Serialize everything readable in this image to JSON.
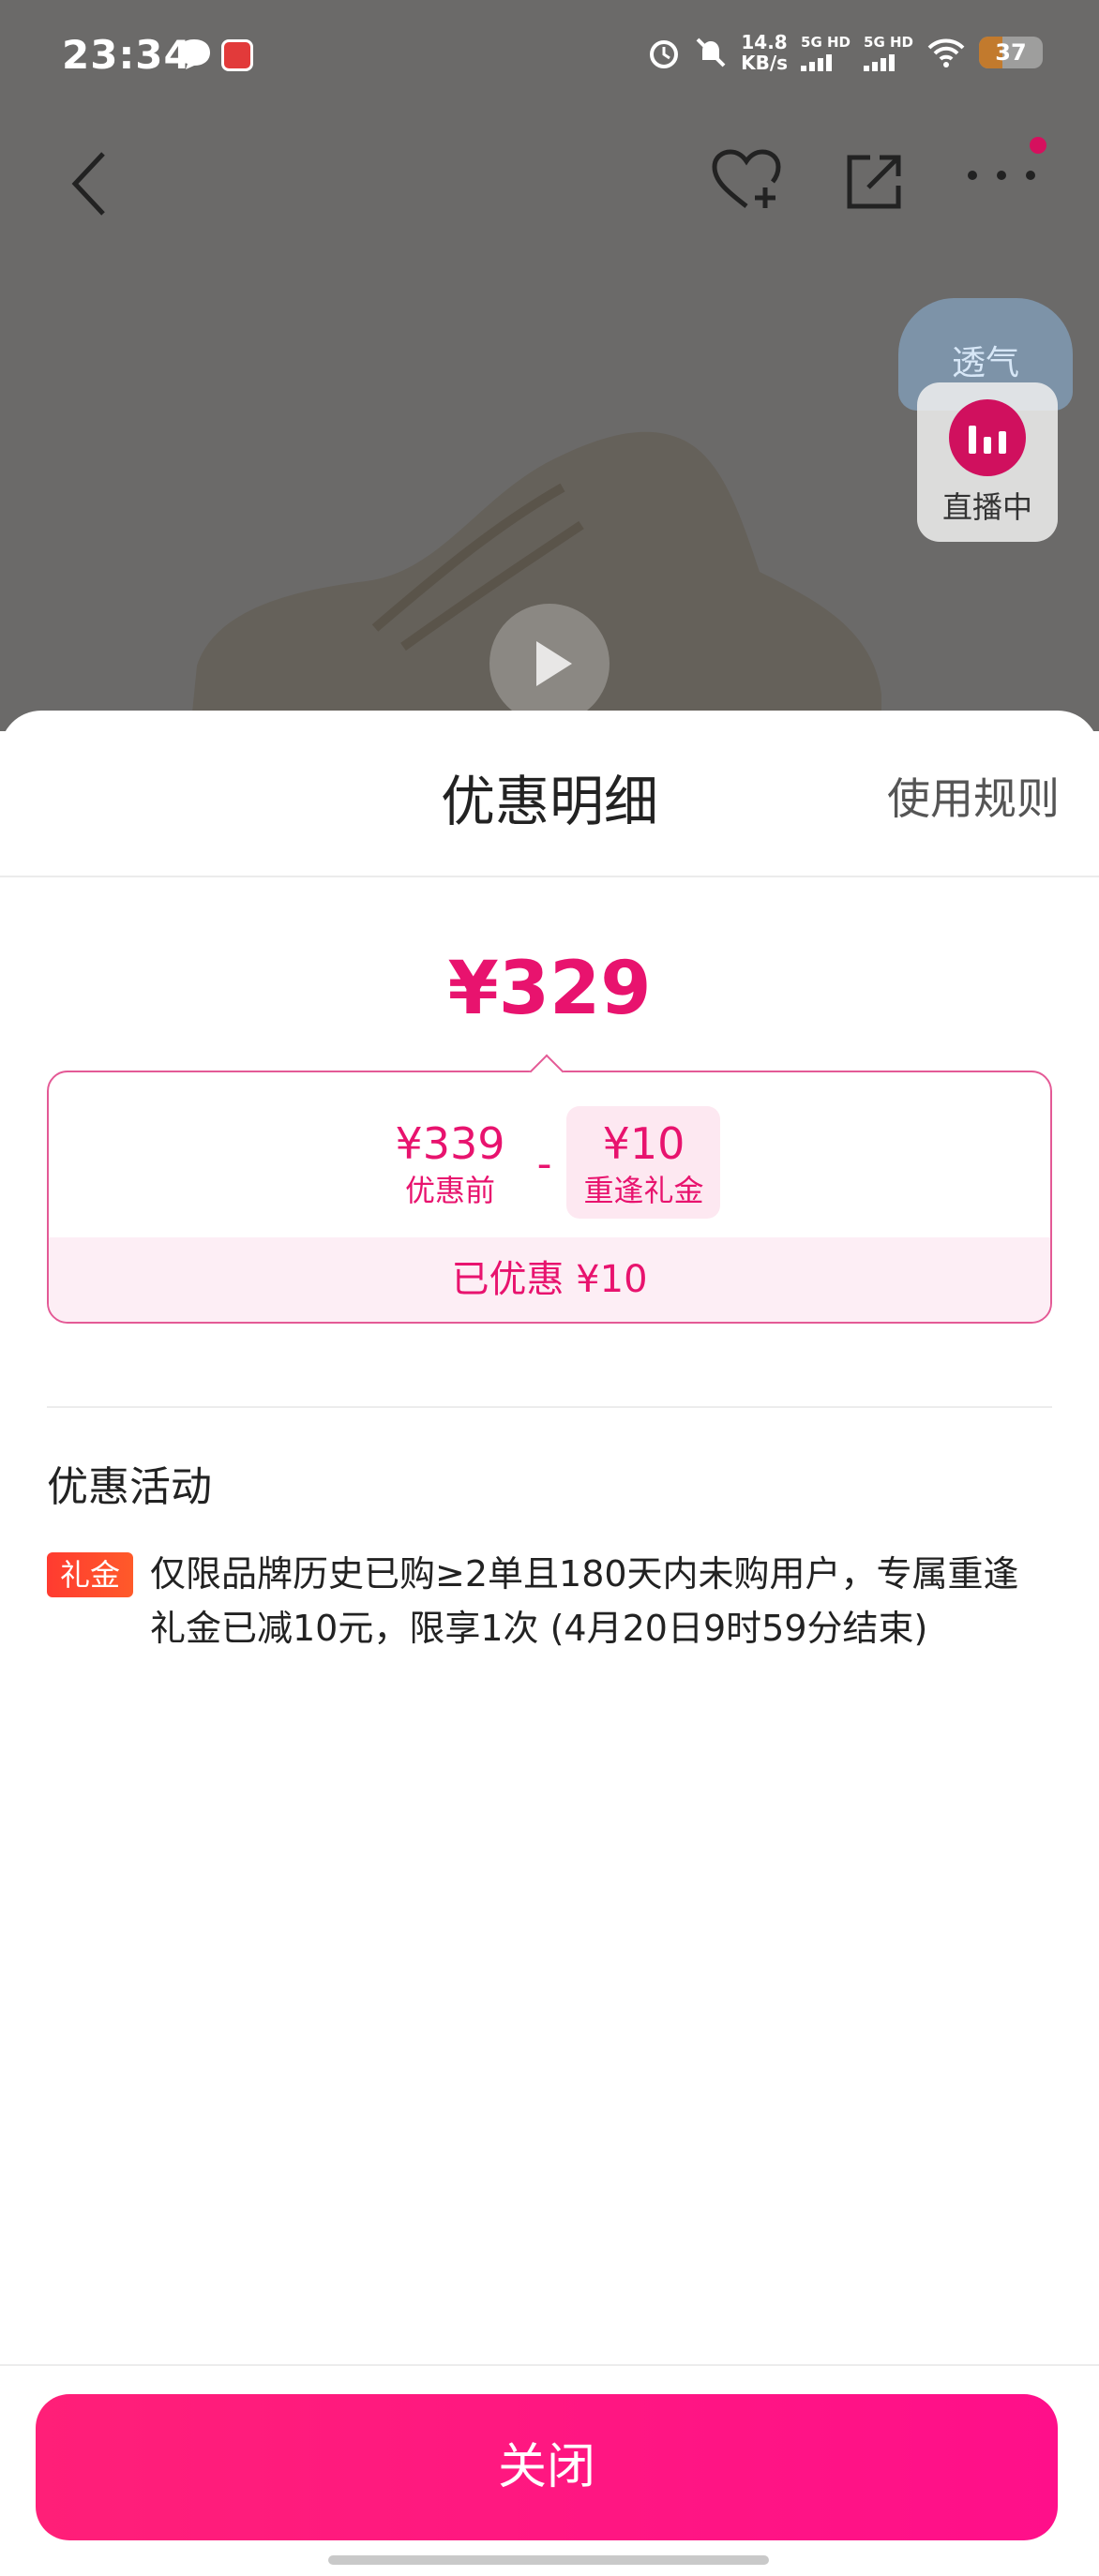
{
  "status_bar": {
    "time": "23:34",
    "speed_value": "14.8",
    "speed_unit": "KB/s",
    "sim1": "5G HD",
    "sim2": "5G HD",
    "battery": "37",
    "battery_level": 0.37
  },
  "product_page": {
    "float_badge": "透气",
    "live_label": "直播中"
  },
  "sheet": {
    "title": "优惠明细",
    "rules_link": "使用规则",
    "final_price": "¥329",
    "breakdown": {
      "original_value": "¥339",
      "original_label": "优惠前",
      "minus": "-",
      "discount_value": "¥10",
      "discount_label": "重逢礼金",
      "saved": "已优惠 ¥10"
    },
    "activities_title": "优惠活动",
    "activity": {
      "tag": "礼金",
      "text": "仅限品牌历史已购≥2单且180天内未购用户，专属重逢礼金已减10元，限享1次 (4月20日9时59分结束)"
    },
    "close_label": "关闭"
  },
  "colors": {
    "accent": "#e8136e",
    "button": "#ff1f78",
    "tag": "#ff3b30"
  }
}
